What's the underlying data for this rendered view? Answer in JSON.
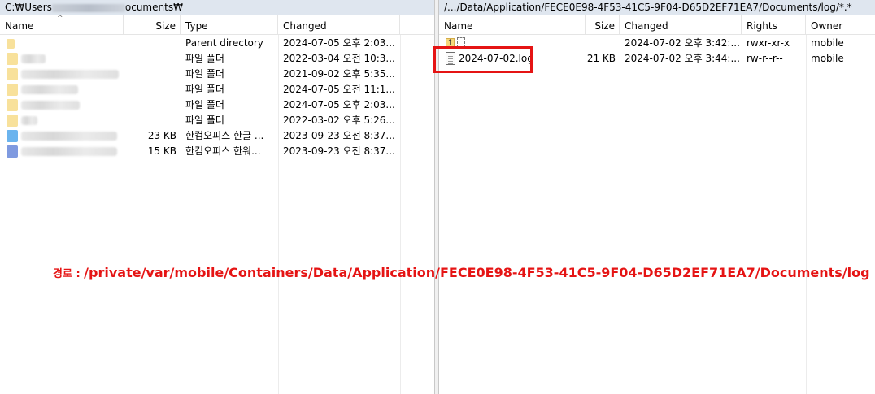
{
  "left": {
    "path_prefix": "C:₩Users",
    "path_suffix": "ocuments₩",
    "columns": {
      "name": "Name",
      "size": "Size",
      "type": "Type",
      "changed": "Changed"
    },
    "rows": [
      {
        "name": "",
        "size": "",
        "type": "Parent directory",
        "changed": "2024-07-05  오후 2:03...",
        "icon": "parent-folder"
      },
      {
        "name": "",
        "size": "",
        "type": "파일 폴더",
        "changed": "2022-03-04  오전 10:3...",
        "icon": "folder"
      },
      {
        "name": "",
        "size": "",
        "type": "파일 폴더",
        "changed": "2021-09-02  오후 5:35...",
        "icon": "folder"
      },
      {
        "name": "",
        "size": "",
        "type": "파일 폴더",
        "changed": "2024-07-05  오전 11:1...",
        "icon": "folder"
      },
      {
        "name": "",
        "size": "",
        "type": "파일 폴더",
        "changed": "2024-07-05  오후 2:03...",
        "icon": "folder"
      },
      {
        "name": "",
        "size": "",
        "type": "파일 폴더",
        "changed": "2022-03-02  오후 5:26...",
        "icon": "folder"
      },
      {
        "name": "",
        "size": "23 KB",
        "type": "한컴오피스 한글 ...",
        "changed": "2023-09-23  오전 8:37...",
        "icon": "hwp-file"
      },
      {
        "name": "",
        "size": "15 KB",
        "type": "한컴오피스 한워...",
        "changed": "2023-09-23  오전 8:37...",
        "icon": "hword-file"
      }
    ]
  },
  "right": {
    "path": "/.../Data/Application/FECE0E98-4F53-41C5-9F04-D65D2EF71EA7/Documents/log/*.*",
    "columns": {
      "name": "Name",
      "size": "Size",
      "changed": "Changed",
      "rights": "Rights",
      "owner": "Owner"
    },
    "rows": [
      {
        "name": "",
        "size": "",
        "changed": "2024-07-02  오후 3:42:...",
        "rights": "rwxr-xr-x",
        "owner": "mobile",
        "icon": "parent-folder"
      },
      {
        "name": "2024-07-02.log",
        "size": "21 KB",
        "changed": "2024-07-02  오후 3:44:...",
        "rights": "rw-r--r--",
        "owner": "mobile",
        "icon": "log-file"
      }
    ]
  },
  "annotation": {
    "label": "경로 : ",
    "path": "/private/var/mobile/Containers/Data/Application/FECE0E98-4F53-41C5-9F04-D65D2EF71EA7/Documents/log"
  },
  "colors": {
    "highlight": "#e51414",
    "folder": "#f6d77a",
    "hwp": "#3a9be8",
    "hword": "#5478d6",
    "pathbar": "#dfe6ef"
  }
}
